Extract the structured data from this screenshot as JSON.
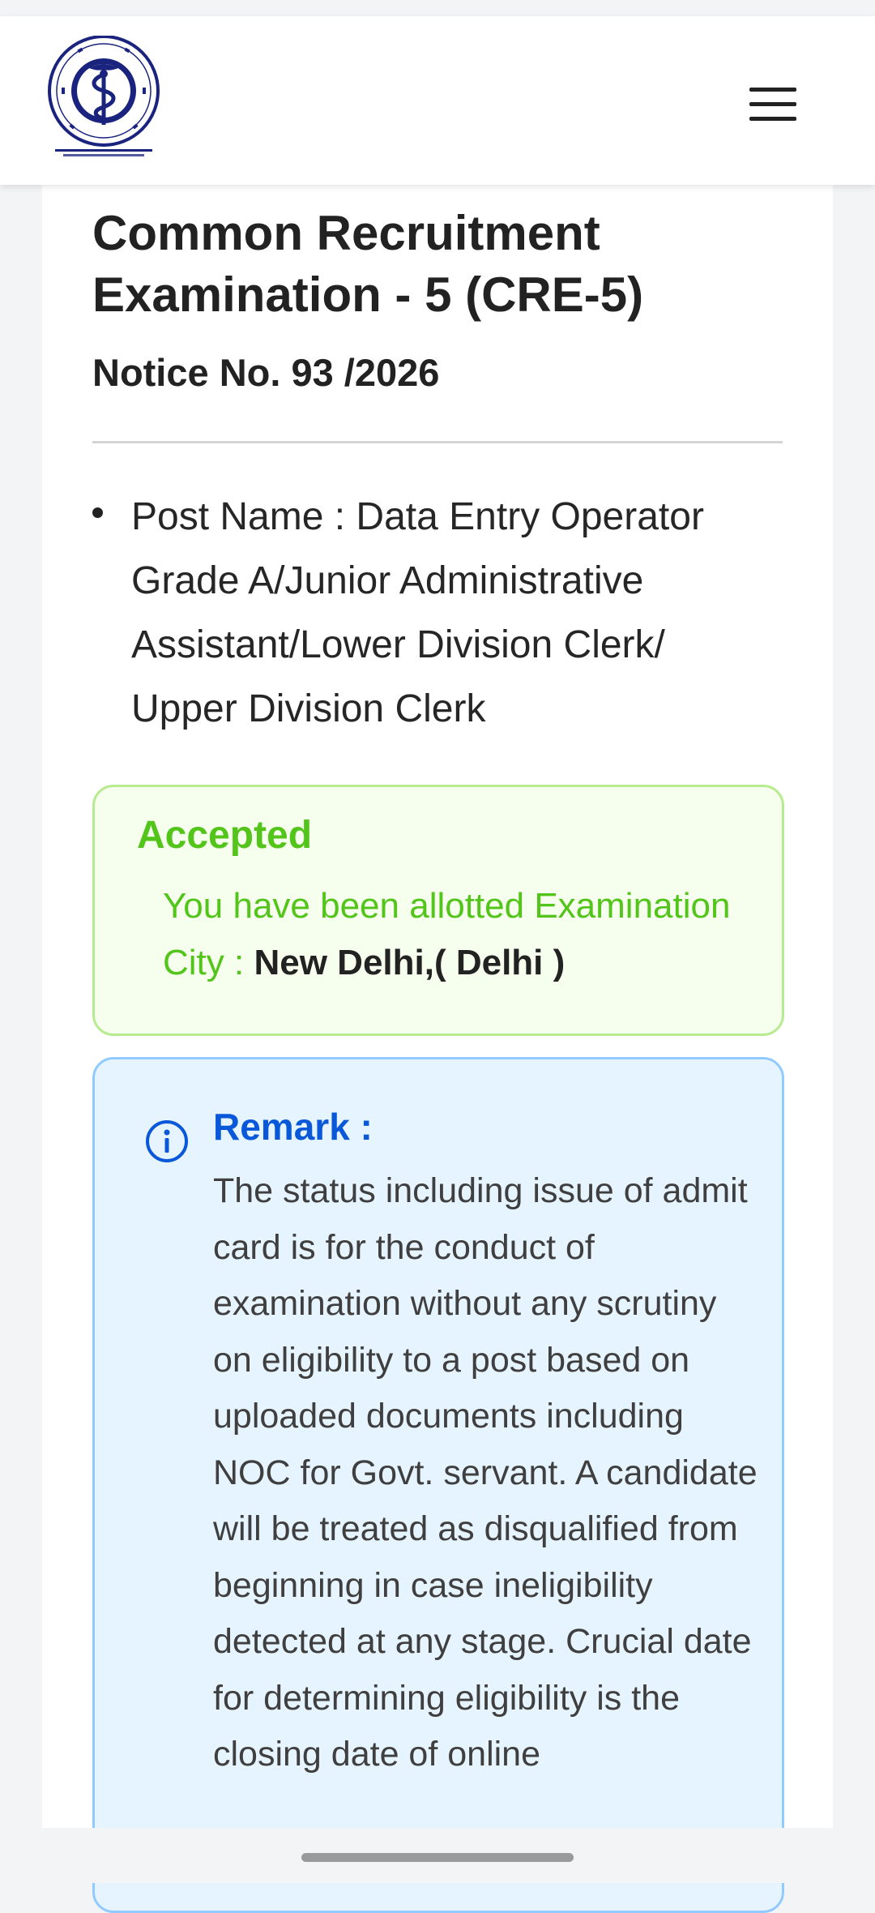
{
  "header": {
    "logo_icon": "aiims-emblem-logo",
    "menu_icon": "hamburger-menu-icon"
  },
  "exam": {
    "title": "Common Recruitment Examination - 5 (CRE-5)",
    "notice": "Notice No. 93 /2026",
    "post_name": "Post Name : Data Entry Operator Grade A/Junior Administrative Assistant/Lower Division Clerk/ Upper Division Clerk"
  },
  "status": {
    "title": "Accepted",
    "message": "You have been allotted Examination City :",
    "city": "New Delhi,( Delhi )",
    "colors": {
      "text": "#52c41a",
      "background": "#f6ffed",
      "border": "#b7eb8f"
    }
  },
  "remark": {
    "icon": "info-circle-icon",
    "title": "Remark :",
    "text": "The status including issue of admit card is for the conduct of examination without any scrutiny on eligibility to a post based on uploaded documents including NOC for Govt. servant. A candidate will be treated as disqualified from beginning in case ineligibility detected at any stage. Crucial date for determining eligibility is the closing date of online",
    "colors": {
      "title": "#0958d9",
      "background": "#e6f4ff",
      "border": "#91caff"
    }
  }
}
